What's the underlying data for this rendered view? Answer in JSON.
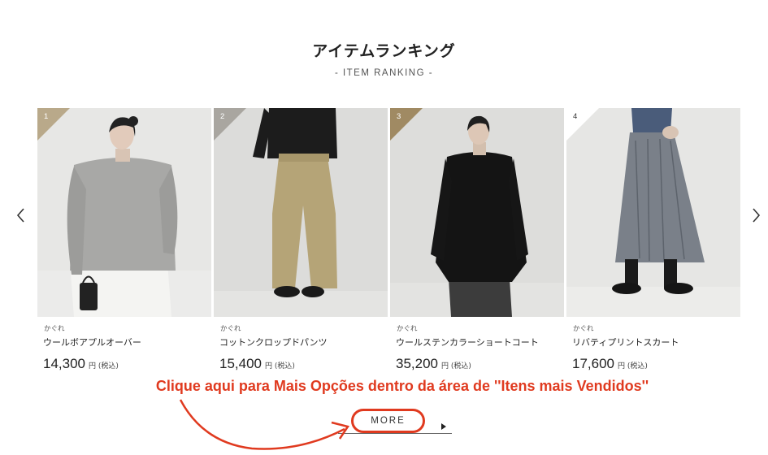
{
  "section": {
    "title": "アイテムランキング",
    "subtitle": "- ITEM RANKING -"
  },
  "carousel": {
    "prev_icon": "chevron-left-icon",
    "next_icon": "chevron-right-icon",
    "items": [
      {
        "rank": "1",
        "rank_color": "#b9a98a",
        "brand": "かぐれ",
        "name": "ウールボアプルオーバー",
        "price": "14,300",
        "price_unit": "円 (税込)"
      },
      {
        "rank": "2",
        "rank_color": "#a9a6a0",
        "brand": "かぐれ",
        "name": "コットンクロップドパンツ",
        "price": "15,400",
        "price_unit": "円 (税込)"
      },
      {
        "rank": "3",
        "rank_color": "#a08a63",
        "brand": "かぐれ",
        "name": "ウールステンカラーショートコート",
        "price": "35,200",
        "price_unit": "円 (税込)"
      },
      {
        "rank": "4",
        "rank_color": "#ffffff",
        "brand": "かぐれ",
        "name": "リバティプリントスカート",
        "price": "17,600",
        "price_unit": "円 (税込)"
      }
    ]
  },
  "annotation": {
    "text": "Clique aqui para Mais Opções dentro da área de ''Itens mais Vendidos''",
    "color": "#e03a1f"
  },
  "more": {
    "label": "MORE",
    "caret_icon": "caret-right-icon"
  }
}
